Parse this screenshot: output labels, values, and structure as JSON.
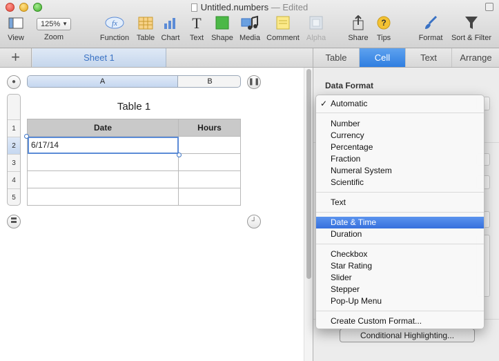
{
  "window": {
    "filename": "Untitled.numbers",
    "separator": " — ",
    "status": "Edited"
  },
  "toolbar": {
    "view": "View",
    "zoom_value": "125%",
    "zoom": "Zoom",
    "function": "Function",
    "table": "Table",
    "chart": "Chart",
    "text": "Text",
    "shape": "Shape",
    "media": "Media",
    "comment": "Comment",
    "alpha": "Alpha",
    "share": "Share",
    "tips": "Tips",
    "format": "Format",
    "sort_filter": "Sort & Filter",
    "function_glyph": "fx",
    "text_glyph": "T",
    "tips_glyph": "?"
  },
  "sheets": {
    "add_glyph": "+",
    "active": "Sheet 1"
  },
  "table": {
    "title": "Table 1",
    "column_letters": [
      "A",
      "B"
    ],
    "row_numbers": [
      "1",
      "2",
      "3",
      "4",
      "5"
    ],
    "headers": [
      "Date",
      "Hours"
    ],
    "rows": [
      [
        "6/17/14",
        ""
      ],
      [
        "",
        ""
      ],
      [
        "",
        ""
      ],
      [
        "",
        ""
      ]
    ],
    "selected_row": "2",
    "selected_cell": "A2"
  },
  "inspector": {
    "tabs": [
      "Table",
      "Cell",
      "Text",
      "Arrange"
    ],
    "active_tab": "Cell",
    "section_title": "Data Format",
    "conditional_button": "Conditional Highlighting..."
  },
  "data_format_menu": {
    "selected": "Automatic",
    "highlighted": "Date & Time",
    "check_glyph": "✓",
    "groups": [
      [
        "Automatic"
      ],
      [
        "Number",
        "Currency",
        "Percentage",
        "Fraction",
        "Numeral System",
        "Scientific"
      ],
      [
        "Text"
      ],
      [
        "Date & Time",
        "Duration"
      ],
      [
        "Checkbox",
        "Star Rating",
        "Slider",
        "Stepper",
        "Pop-Up Menu"
      ],
      [
        "Create Custom Format..."
      ]
    ]
  },
  "colors": {
    "accent": "#3a72c4",
    "tab_active": "#2f7ee0",
    "menu_highlight": "#3670dc",
    "shape_green": "#4cb847"
  }
}
